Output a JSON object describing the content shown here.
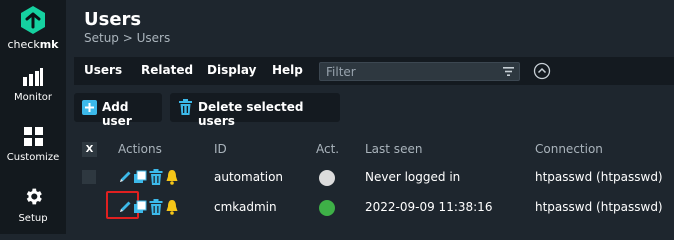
{
  "app": {
    "logo_text_a": "check",
    "logo_text_b": "mk"
  },
  "sidebar": {
    "items": [
      {
        "label": "Monitor",
        "icon": "bar-chart-icon"
      },
      {
        "label": "Customize",
        "icon": "grid-icon"
      },
      {
        "label": "Setup",
        "icon": "gear-icon"
      }
    ]
  },
  "header": {
    "title": "Users",
    "breadcrumb": "Setup > Users"
  },
  "menu": {
    "items": [
      "Users",
      "Related",
      "Display",
      "Help"
    ],
    "filter_placeholder": "Filter"
  },
  "toolbar": {
    "add_label": "Add user",
    "delete_label": "Delete selected users"
  },
  "table": {
    "select_all": "X",
    "columns": [
      "Actions",
      "ID",
      "Act.",
      "Last seen",
      "Connection"
    ],
    "rows": [
      {
        "id": "automation",
        "active": false,
        "last_seen": "Never logged in",
        "connection": "htpasswd (htpasswd)"
      },
      {
        "id": "cmkadmin",
        "active": true,
        "last_seen": "2022-09-09 11:38:16",
        "connection": "htpasswd (htpasswd)"
      }
    ]
  },
  "colors": {
    "brand": "#15d1a0",
    "accent": "#3cb9ea",
    "bell": "#f5c518",
    "active_dot": "#3eb047",
    "inactive_dot": "#dcdcdc",
    "highlight": "#e02020"
  }
}
